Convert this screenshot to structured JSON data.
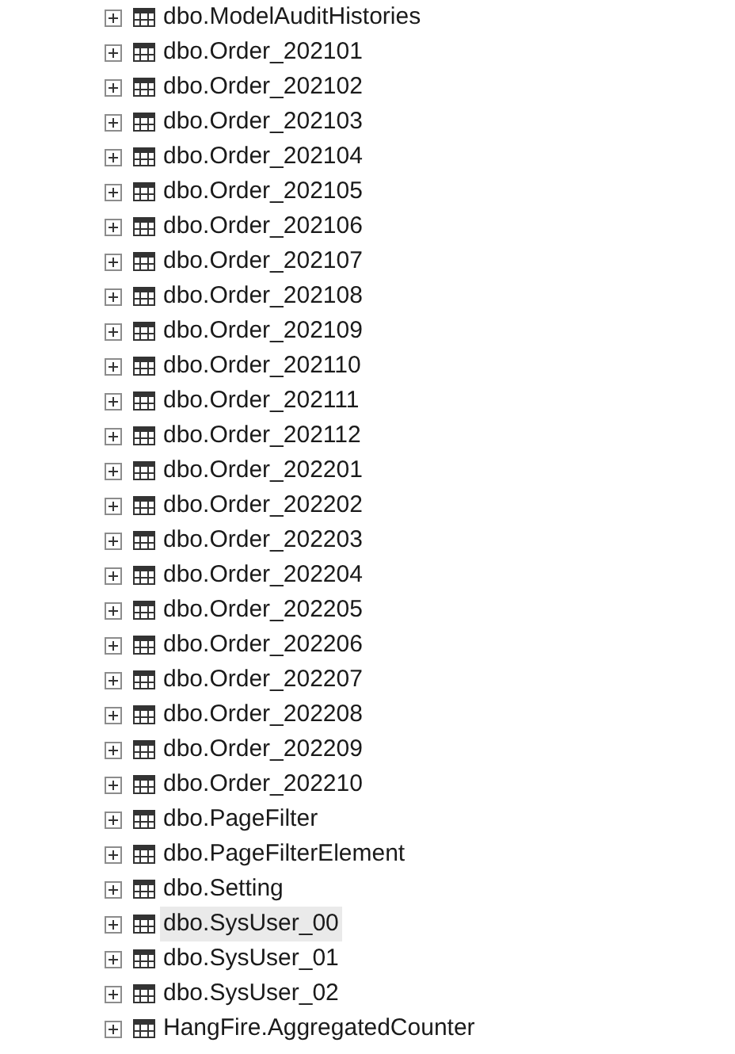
{
  "tree": {
    "items": [
      {
        "label": "dbo.ModelAuditHistories",
        "expanded": false,
        "selected": false
      },
      {
        "label": "dbo.Order_202101",
        "expanded": false,
        "selected": false
      },
      {
        "label": "dbo.Order_202102",
        "expanded": false,
        "selected": false
      },
      {
        "label": "dbo.Order_202103",
        "expanded": false,
        "selected": false
      },
      {
        "label": "dbo.Order_202104",
        "expanded": false,
        "selected": false
      },
      {
        "label": "dbo.Order_202105",
        "expanded": false,
        "selected": false
      },
      {
        "label": "dbo.Order_202106",
        "expanded": false,
        "selected": false
      },
      {
        "label": "dbo.Order_202107",
        "expanded": false,
        "selected": false
      },
      {
        "label": "dbo.Order_202108",
        "expanded": false,
        "selected": false
      },
      {
        "label": "dbo.Order_202109",
        "expanded": false,
        "selected": false
      },
      {
        "label": "dbo.Order_202110",
        "expanded": false,
        "selected": false
      },
      {
        "label": "dbo.Order_202111",
        "expanded": false,
        "selected": false
      },
      {
        "label": "dbo.Order_202112",
        "expanded": false,
        "selected": false
      },
      {
        "label": "dbo.Order_202201",
        "expanded": false,
        "selected": false
      },
      {
        "label": "dbo.Order_202202",
        "expanded": false,
        "selected": false
      },
      {
        "label": "dbo.Order_202203",
        "expanded": false,
        "selected": false
      },
      {
        "label": "dbo.Order_202204",
        "expanded": false,
        "selected": false
      },
      {
        "label": "dbo.Order_202205",
        "expanded": false,
        "selected": false
      },
      {
        "label": "dbo.Order_202206",
        "expanded": false,
        "selected": false
      },
      {
        "label": "dbo.Order_202207",
        "expanded": false,
        "selected": false
      },
      {
        "label": "dbo.Order_202208",
        "expanded": false,
        "selected": false
      },
      {
        "label": "dbo.Order_202209",
        "expanded": false,
        "selected": false
      },
      {
        "label": "dbo.Order_202210",
        "expanded": false,
        "selected": false
      },
      {
        "label": "dbo.PageFilter",
        "expanded": false,
        "selected": false
      },
      {
        "label": "dbo.PageFilterElement",
        "expanded": false,
        "selected": false
      },
      {
        "label": "dbo.Setting",
        "expanded": false,
        "selected": false
      },
      {
        "label": "dbo.SysUser_00",
        "expanded": false,
        "selected": true
      },
      {
        "label": "dbo.SysUser_01",
        "expanded": false,
        "selected": false
      },
      {
        "label": "dbo.SysUser_02",
        "expanded": false,
        "selected": false
      },
      {
        "label": "HangFire.AggregatedCounter",
        "expanded": false,
        "selected": false
      }
    ]
  }
}
